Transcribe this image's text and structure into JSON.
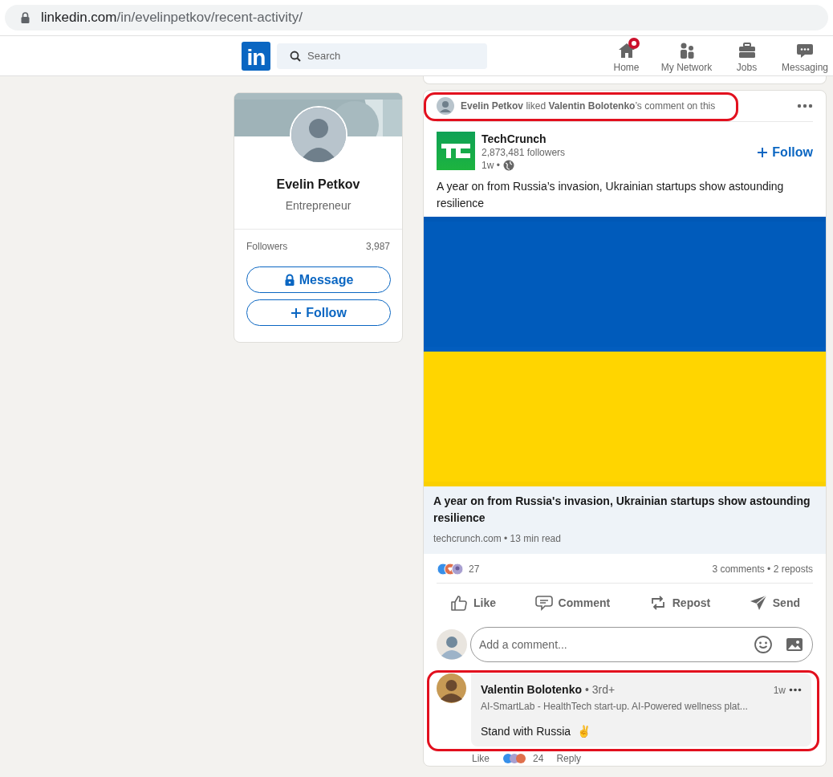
{
  "address_bar": {
    "host": "linkedin.com",
    "path": "/in/evelinpetkov/recent-activity/"
  },
  "navbar": {
    "logo": "in",
    "search": {
      "placeholder": "Search"
    },
    "items": [
      {
        "label": "Home",
        "notification": true
      },
      {
        "label": "My Network",
        "notification": false
      },
      {
        "label": "Jobs",
        "notification": false
      },
      {
        "label": "Messaging",
        "notification": false
      }
    ]
  },
  "profile": {
    "name": "Evelin Petkov",
    "headline": "Entrepreneur",
    "stats": [
      {
        "label": "Followers",
        "value": "3,987"
      }
    ],
    "buttons": [
      {
        "label": "Message"
      },
      {
        "label": "Follow"
      }
    ]
  },
  "post": {
    "activity": {
      "text": "**Evelin Petkov** liked **Valentin Bolotenko**’s comment on this",
      "highlighted": true
    },
    "author": {
      "name": "TechCrunch",
      "followers": "2,873,481 followers",
      "time": "1w •",
      "follow": "Follow"
    },
    "text": "A year on from Russia’s invasion, Ukrainian startups show astounding resilience",
    "link": {
      "title": "A year on from Russia's invasion, Ukrainian startups show astounding resilience",
      "meta": "techcrunch.com • 13 min read"
    },
    "reactions": {
      "count": "27",
      "summary": "3 comments • 2 reposts"
    },
    "actions": [
      {
        "label": "Like"
      },
      {
        "label": "Comment"
      },
      {
        "label": "Repost"
      },
      {
        "label": "Send"
      }
    ],
    "comment_box": {
      "placeholder": "Add a comment..."
    },
    "comments": [
      {
        "name": "Valentin Bolotenko",
        "degree": "• 3rd+",
        "headline": "AI-SmartLab - HealthTech start-up. AI-Powered wellness plat...",
        "time": "1w",
        "text": "Stand with Russia",
        "emoji": "✌",
        "highlighted": true,
        "footer": {
          "like": "Like",
          "count": "24",
          "reply": "Reply"
        }
      }
    ]
  }
}
